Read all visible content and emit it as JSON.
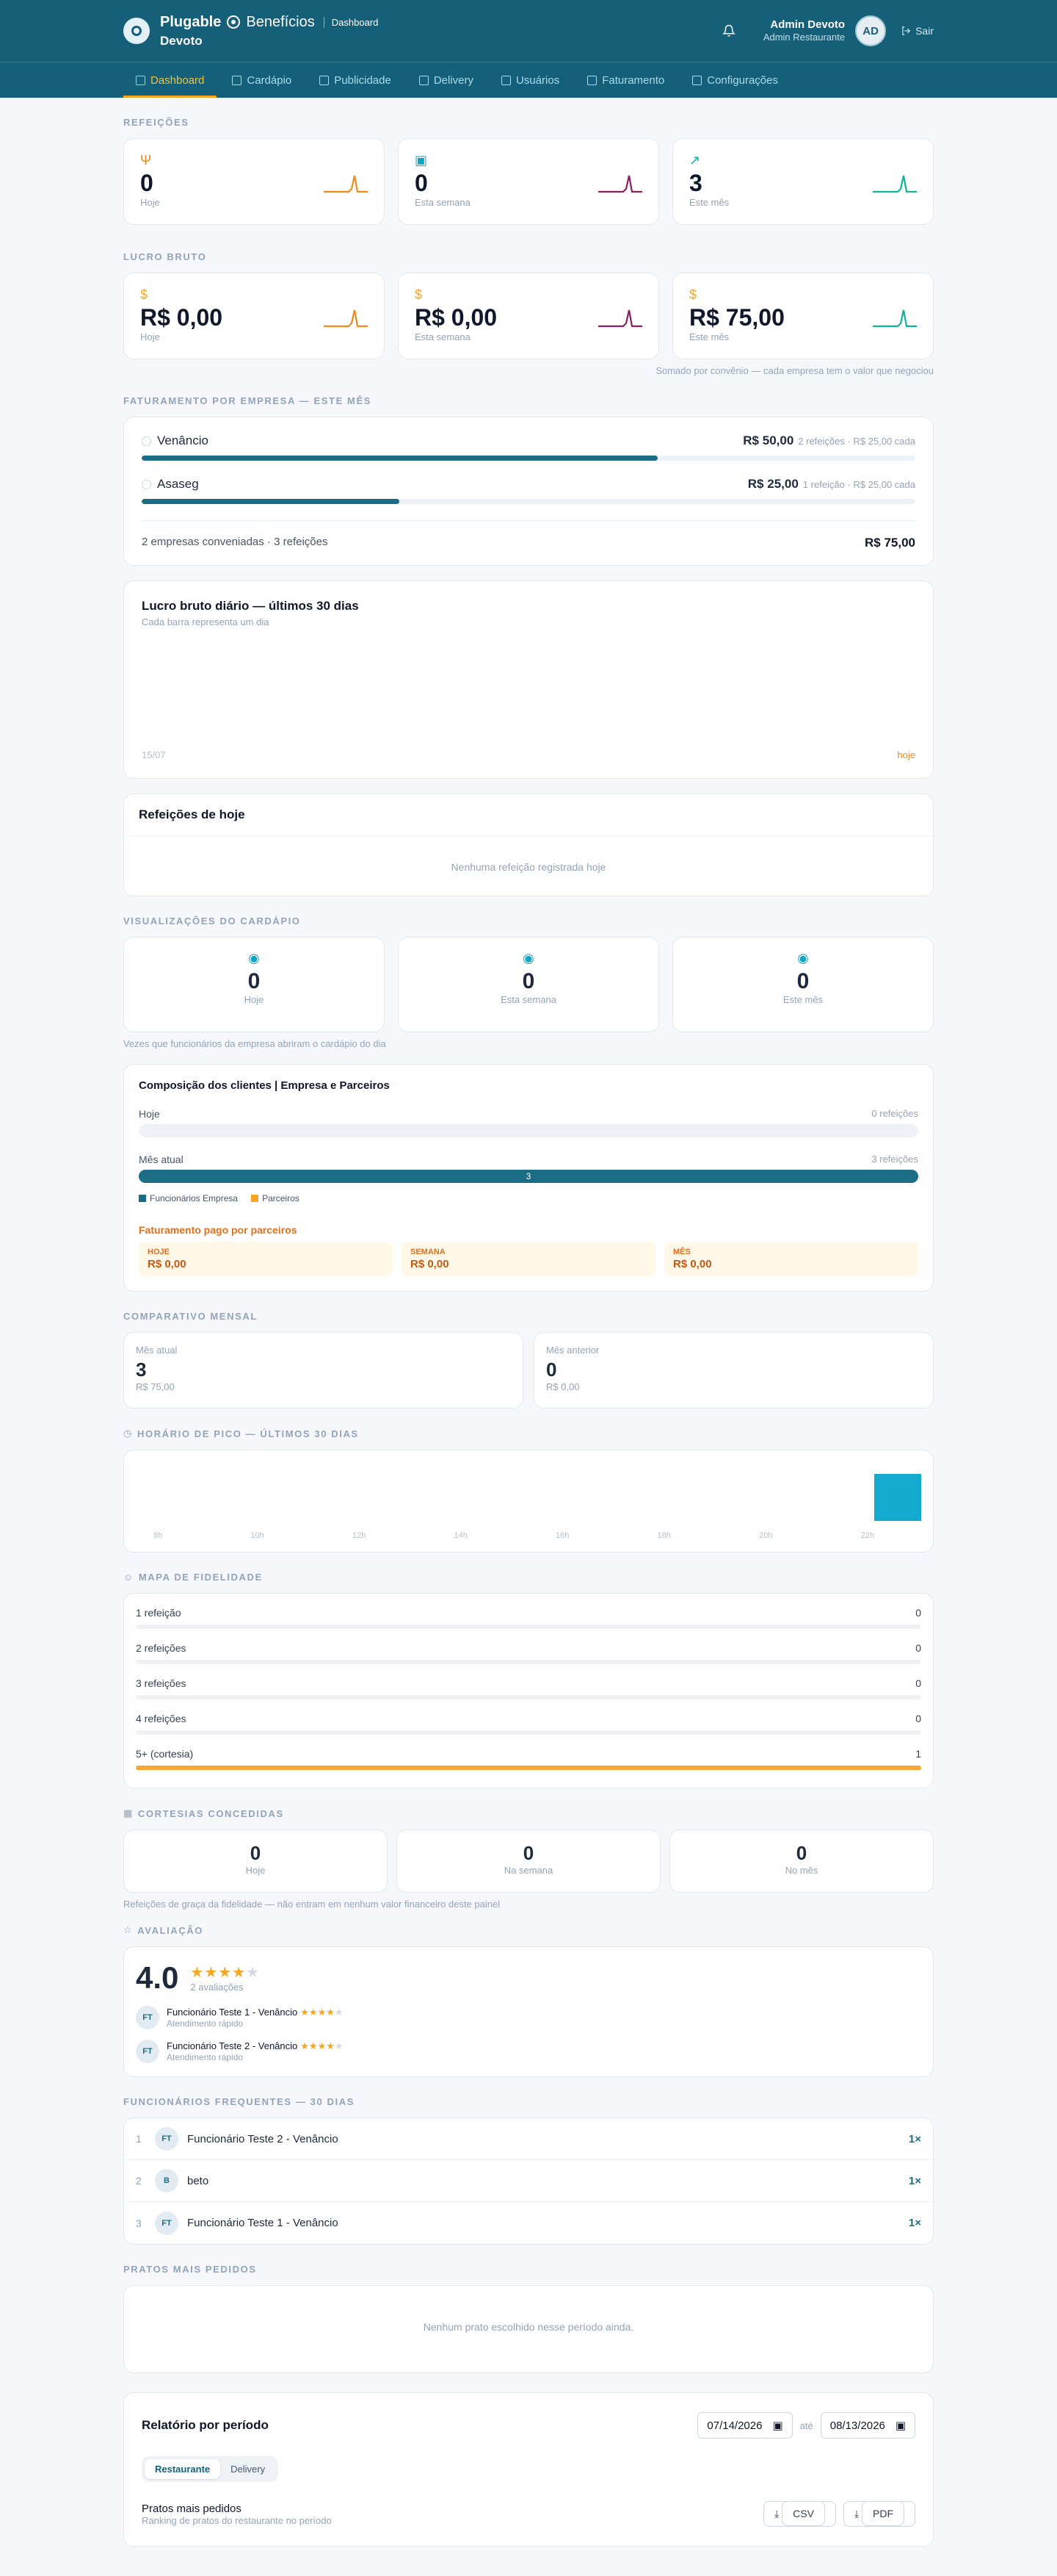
{
  "header": {
    "brand": "Plugable",
    "brand_product": "Benefícios",
    "breadcrumb": "Dashboard",
    "restaurant": "Devoto",
    "user_name": "Admin Devoto",
    "user_role": "Admin Restaurante",
    "avatar_initials": "AD",
    "logout_label": "Sair"
  },
  "nav": [
    {
      "label": "Dashboard",
      "icon": "bar-chart-icon"
    },
    {
      "label": "Cardápio",
      "icon": "book-icon"
    },
    {
      "label": "Publicidade",
      "icon": "megaphone-icon"
    },
    {
      "label": "Delivery",
      "icon": "bike-icon"
    },
    {
      "label": "Usuários",
      "icon": "users-icon"
    },
    {
      "label": "Faturamento",
      "icon": "receipt-icon"
    },
    {
      "label": "Configurações",
      "icon": "gear-icon"
    }
  ],
  "colors": {
    "primary": "#155f78",
    "accent": "#f3a51d",
    "orange": "#f08a1b",
    "purple": "#8b1e5e",
    "green": "#10b39a"
  },
  "refeicoes": {
    "label": "Refeições",
    "cards": [
      {
        "value": "0",
        "label": "Hoje",
        "icon": "fork-knife-icon"
      },
      {
        "value": "0",
        "label": "Esta semana",
        "icon": "calendar-icon"
      },
      {
        "value": "3",
        "label": "Este mês",
        "icon": "trend-up-icon"
      }
    ]
  },
  "lucro": {
    "label": "Lucro bruto",
    "cards": [
      {
        "value": "R$ 0,00",
        "label": "Hoje",
        "icon": "dollar-icon"
      },
      {
        "value": "R$ 0,00",
        "label": "Esta semana",
        "icon": "dollar-icon"
      },
      {
        "value": "R$ 75,00",
        "label": "Este mês",
        "icon": "dollar-icon"
      }
    ],
    "note": "Somado por convênio — cada empresa tem o valor que negociou"
  },
  "faturamento": {
    "label": "Faturamento por empresa — este mês",
    "rows": [
      {
        "name": "Venâncio",
        "value": "R$ 50,00",
        "detail": "2 refeições · R$ 25,00 cada",
        "share": 0.667
      },
      {
        "name": "Asaseg",
        "value": "R$ 25,00",
        "detail": "1 refeição · R$ 25,00 cada",
        "share": 0.333
      }
    ],
    "footer_left": "2 empresas conveniadas · 3 refeições",
    "footer_total": "R$ 75,00"
  },
  "daily": {
    "title": "Lucro bruto diário — últimos 30 dias",
    "subtitle": "Cada barra representa um dia",
    "axis_start": "15/07",
    "axis_end": "hoje"
  },
  "meals_today": {
    "title": "Refeições de hoje",
    "empty": "Nenhuma refeição registrada hoje"
  },
  "views": {
    "label": "Visualizações do cardápio",
    "cards": [
      {
        "value": "0",
        "label": "Hoje"
      },
      {
        "value": "0",
        "label": "Esta semana"
      },
      {
        "value": "0",
        "label": "Este mês"
      }
    ],
    "note": "Vezes que funcionários da empresa abriram o cardápio do dia"
  },
  "composition": {
    "title": "Composição dos clientes | Empresa e Parceiros",
    "today_label": "Hoje",
    "today_count": "0 refeições",
    "month_label": "Mês atual",
    "month_count": "3 refeições",
    "month_bar_value": "3",
    "legend_company": "Funcionários Empresa",
    "legend_partner": "Parceiros",
    "partner_title": "Faturamento pago por parceiros",
    "partner_boxes": [
      {
        "label": "HOJE",
        "value": "R$ 0,00"
      },
      {
        "label": "SEMANA",
        "value": "R$ 0,00"
      },
      {
        "label": "MÊS",
        "value": "R$ 0,00"
      }
    ]
  },
  "monthly": {
    "label": "Comparativo mensal",
    "current": {
      "title": "Mês atual",
      "value": "3",
      "sub": "R$ 75,00"
    },
    "previous": {
      "title": "Mês anterior",
      "value": "0",
      "sub": "R$ 0,00"
    }
  },
  "peak": {
    "label": "Horário de pico — últimos 30 dias",
    "ticks": [
      "8h",
      "10h",
      "12h",
      "14h",
      "16h",
      "18h",
      "20h",
      "22h"
    ]
  },
  "loyalty": {
    "label": "Mapa de fidelidade",
    "rows": [
      {
        "label": "1 refeição",
        "count": "0"
      },
      {
        "label": "2 refeições",
        "count": "0"
      },
      {
        "label": "3 refeições",
        "count": "0"
      },
      {
        "label": "4 refeições",
        "count": "0"
      },
      {
        "label": "5+ (cortesia)",
        "count": "1"
      }
    ]
  },
  "courtesies": {
    "label": "Cortesias concedidas",
    "cards": [
      {
        "value": "0",
        "label": "Hoje"
      },
      {
        "value": "0",
        "label": "Na semana"
      },
      {
        "value": "0",
        "label": "No mês"
      }
    ],
    "note": "Refeições de graça da fidelidade — não entram em nenhum valor financeiro deste painel"
  },
  "rating": {
    "label": "Avaliação",
    "score": "4.0",
    "count": "2 avaliações",
    "reviews": [
      {
        "initials": "FT",
        "name": "Funcionário Teste 1 - Venâncio",
        "comment": "Atendimento rápido",
        "stars": 4
      },
      {
        "initials": "FT",
        "name": "Funcionário Teste 2 - Venâncio",
        "comment": "Atendimento rápido",
        "stars": 4
      }
    ]
  },
  "employees": {
    "label": "Funcionários frequentes — 30 dias",
    "rows": [
      {
        "rank": "1",
        "initials": "FT",
        "name": "Funcionário Teste 2 - Venâncio",
        "count": "1×"
      },
      {
        "rank": "2",
        "initials": "B",
        "name": "beto",
        "count": "1×"
      },
      {
        "rank": "3",
        "initials": "FT",
        "name": "Funcionário Teste 1 - Venâncio",
        "count": "1×"
      }
    ]
  },
  "dishes": {
    "label": "Pratos mais pedidos",
    "empty": "Nenhum prato escolhido nesse período ainda."
  },
  "report": {
    "title": "Relatório por período",
    "date_from": "07/14/2026",
    "date_sep": "até",
    "date_to": "08/13/2026",
    "tab_restaurant": "Restaurante",
    "tab_delivery": "Delivery",
    "section_title": "Pratos mais pedidos",
    "section_sub": "Ranking de pratos do restaurante no período",
    "csv_label": "CSV",
    "pdf_label": "PDF"
  }
}
